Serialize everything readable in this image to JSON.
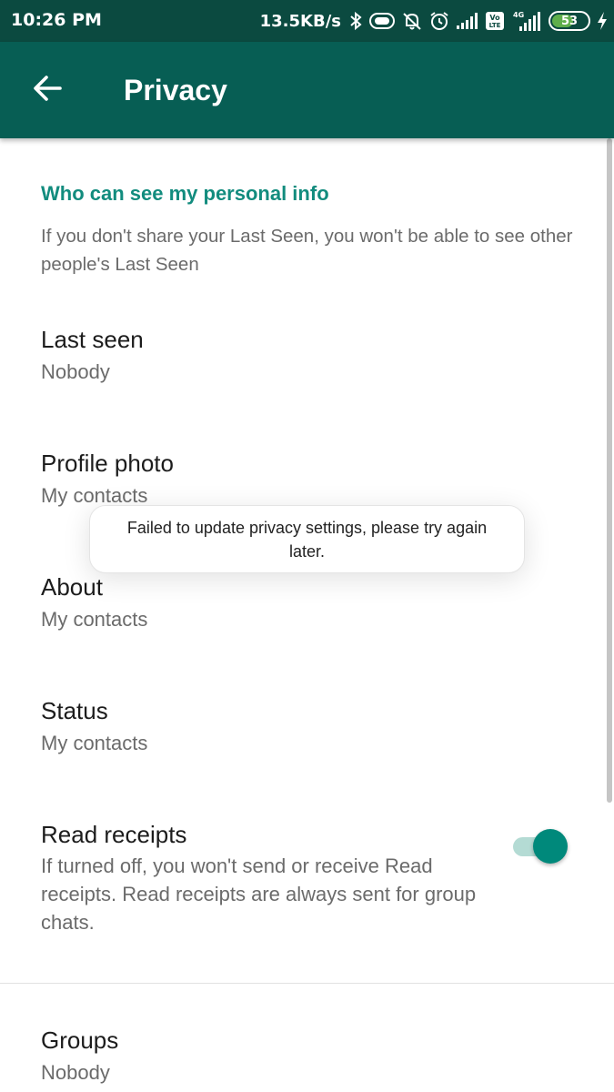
{
  "status_bar": {
    "time": "10:26 PM",
    "network_speed": "13.5KB/s",
    "battery_level": "53",
    "icons": [
      "bluetooth-icon",
      "vibrate-icon",
      "mute-notifications-icon",
      "alarm-icon",
      "signal-icon",
      "volte-icon",
      "4g-signal-icon",
      "battery-icon",
      "charging-icon"
    ],
    "network_label": "4G",
    "volte_label": "Vo LTE"
  },
  "app_bar": {
    "title": "Privacy",
    "back_icon": "arrow-left-icon",
    "background": "#075e54"
  },
  "section": {
    "header": "Who can see my personal info",
    "description": "If you don't share your Last Seen, you won't be able to see other people's Last Seen"
  },
  "settings": {
    "last_seen": {
      "title": "Last seen",
      "value": "Nobody"
    },
    "profile_photo": {
      "title": "Profile photo",
      "value": "My contacts"
    },
    "about": {
      "title": "About",
      "value": "My contacts"
    },
    "status": {
      "title": "Status",
      "value": "My contacts"
    },
    "read_receipts": {
      "title": "Read receipts",
      "description": "If turned off, you won't send or receive Read receipts. Read receipts are always sent for group chats.",
      "enabled": true
    },
    "groups": {
      "title": "Groups",
      "value": "Nobody"
    }
  },
  "toast": {
    "message": "Failed to update privacy settings, please try again later."
  },
  "colors": {
    "accent": "#128c7e",
    "status_bar": "#0b4a40",
    "toggle_on": "#00897b"
  }
}
